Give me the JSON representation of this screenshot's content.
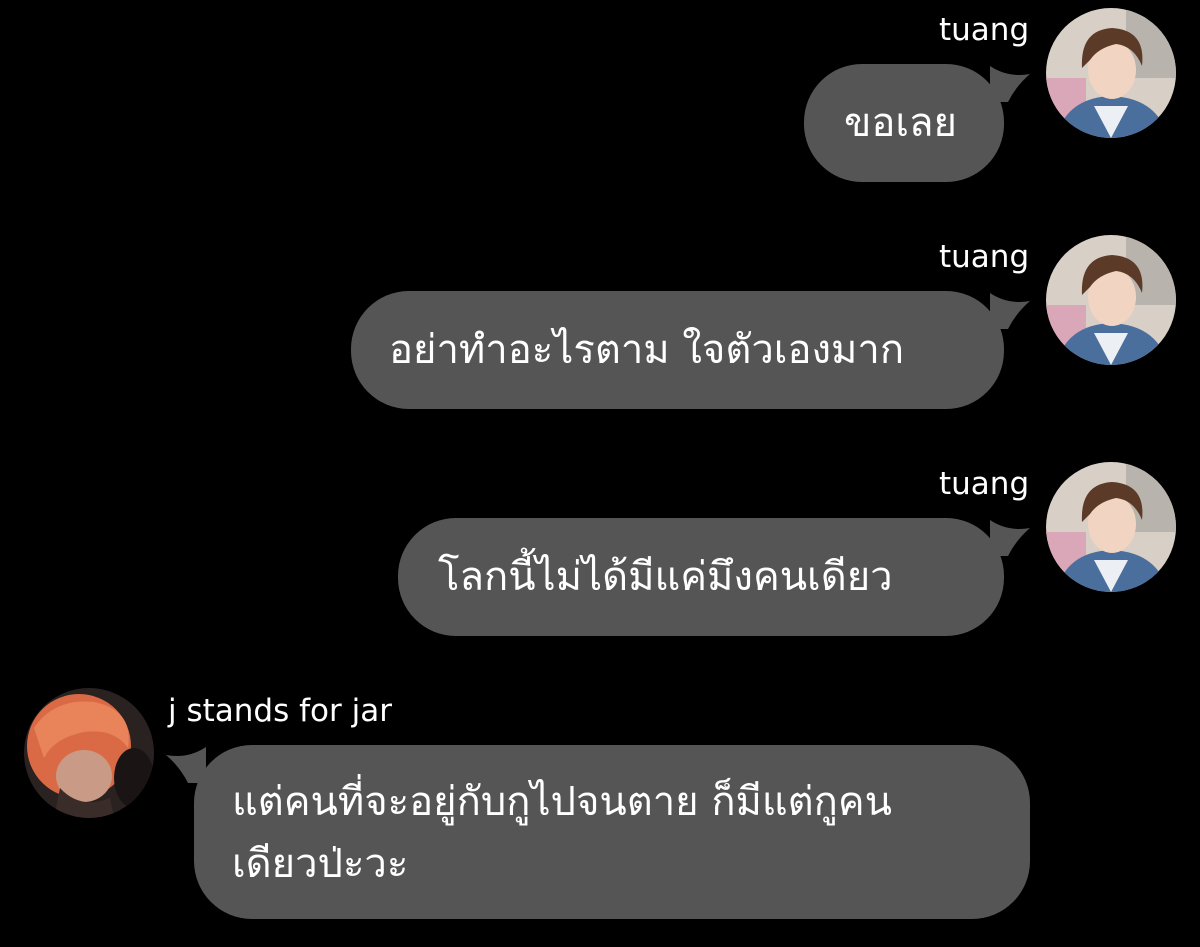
{
  "messages": [
    {
      "sender": "tuang",
      "text": "ขอเลย",
      "side": "right",
      "avatar": "avatar-tuang-icon"
    },
    {
      "sender": "tuang",
      "text": "อย่าทำอะไรตาม ใจตัวเองมาก",
      "side": "right",
      "avatar": "avatar-tuang-icon"
    },
    {
      "sender": "tuang",
      "text": "โลกนี้ไม่ได้มีแค่มึงคนเดียว",
      "side": "right",
      "avatar": "avatar-tuang-icon"
    },
    {
      "sender": "j stands for jar",
      "text_lines": [
        "แต่คนที่จะอยู่กับกูไปจนตาย ก็มีแต่กูคน",
        "เดียวป่ะวะ"
      ],
      "side": "left",
      "avatar": "avatar-jar-icon"
    }
  ],
  "colors": {
    "background": "#000000",
    "bubble": "#555555",
    "text": "#ffffff"
  }
}
